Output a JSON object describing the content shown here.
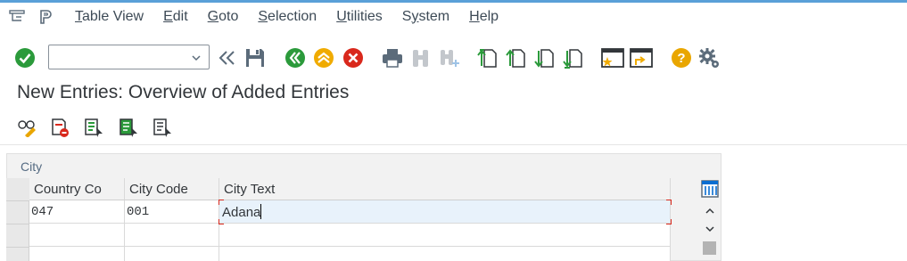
{
  "menubar": {
    "items": [
      {
        "label": "Table View",
        "mnemonic": "T"
      },
      {
        "label": "Edit",
        "mnemonic": "E"
      },
      {
        "label": "Goto",
        "mnemonic": "G"
      },
      {
        "label": "Selection",
        "mnemonic": "S"
      },
      {
        "label": "Utilities",
        "mnemonic": "U"
      },
      {
        "label": "System",
        "mnemonic": "y"
      },
      {
        "label": "Help",
        "mnemonic": "H"
      }
    ]
  },
  "toolbar": {
    "command_field_value": "",
    "icons": [
      "enter-check-icon",
      "collapse-arrows-icon",
      "save-icon",
      "back-icon",
      "exit-icon",
      "cancel-icon",
      "print-icon",
      "find-icon",
      "find-next-icon",
      "first-page-icon",
      "previous-page-icon",
      "next-page-icon",
      "last-page-icon",
      "create-session-icon",
      "shortcut-icon",
      "help-icon",
      "settings-gear-icon"
    ]
  },
  "page": {
    "title": "New Entries: Overview of Added Entries"
  },
  "app_toolbar": {
    "icons": [
      "display-change-icon",
      "delete-row-icon",
      "select-all-icon",
      "select-block-icon",
      "deselect-all-icon"
    ]
  },
  "table": {
    "panel_title": "City",
    "columns": [
      "Country Co",
      "City Code",
      "City Text"
    ],
    "rows": [
      {
        "country": "047",
        "city_code": "001",
        "city_text": "Adana"
      },
      {
        "country": "",
        "city_code": "",
        "city_text": ""
      },
      {
        "country": "",
        "city_code": "",
        "city_text": ""
      }
    ]
  },
  "colors": {
    "accent_blue": "#0a6ed1",
    "enter_green": "#2b9a3b",
    "back_green": "#2b9a3b",
    "exit_orange": "#f0ab00",
    "cancel_red": "#d9281c",
    "help_yellow": "#e9a600",
    "active_row": "#e8f2fb"
  }
}
